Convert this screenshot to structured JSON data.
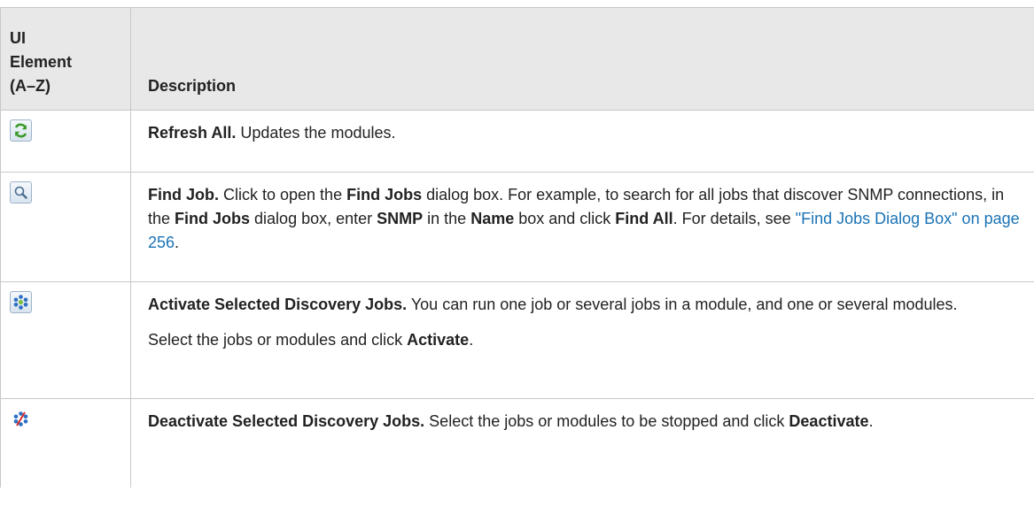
{
  "header": {
    "col1_line1": "UI",
    "col1_line2": "Element",
    "col1_line3": "(A–Z)",
    "col2": "Description"
  },
  "rows": [
    {
      "icon": "refresh-all-icon",
      "title": "Refresh All.",
      "text": " Updates the modules."
    },
    {
      "icon": "find-job-icon",
      "title": "Find Job.",
      "t1": " Click to open the ",
      "b1": "Find Jobs",
      "t2": " dialog box. For example, to search for all jobs that discover SNMP connections, in the ",
      "b2": "Find Jobs",
      "t3": " dialog box, enter ",
      "b3": "SNMP",
      "t4": " in the ",
      "b4": "Name",
      "t5": " box and click ",
      "b5": "Find All",
      "t6": ". For details, see ",
      "link": "\"Find Jobs Dialog Box\" on page 256",
      "t7": "."
    },
    {
      "icon": "activate-jobs-icon",
      "title": "Activate Selected Discovery Jobs.",
      "t1": " You can run one job or several jobs in a module, and one or several modules.",
      "p2_t1": "Select the jobs or modules and click ",
      "p2_b1": "Activate",
      "p2_t2": "."
    },
    {
      "icon": "deactivate-jobs-icon",
      "title": "Deactivate Selected Discovery Jobs.",
      "t1": " Select the jobs or modules to be stopped and click ",
      "b1": "Deactivate",
      "t2": "."
    }
  ]
}
